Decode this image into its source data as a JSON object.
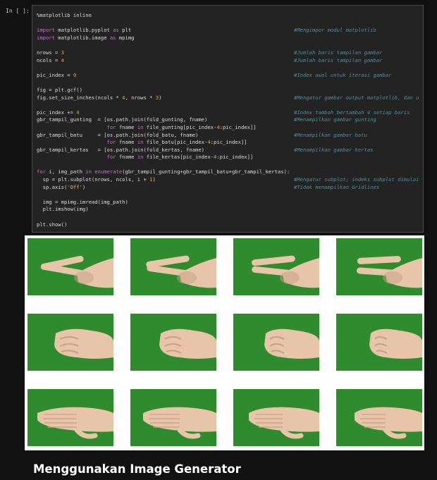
{
  "cell": {
    "prompt": "In [ ]:",
    "lines": [
      {
        "code": "%matplotlib inline",
        "comment": ""
      },
      {
        "code": "",
        "comment": ""
      },
      {
        "code": "import matplotlib.pyplot as plt",
        "comment": "#Mengimpor modul matplotlib"
      },
      {
        "code": "import matplotlib.image as mpimg",
        "comment": ""
      },
      {
        "code": "",
        "comment": ""
      },
      {
        "code": "nrows = 3",
        "comment": "#Jumlah baris tampilan gambar"
      },
      {
        "code": "ncols = 4",
        "comment": "#Jumlah baris tampilan gambar"
      },
      {
        "code": "",
        "comment": ""
      },
      {
        "code": "pic_index = 0",
        "comment": "#Index awal untuk iterasi gambar"
      },
      {
        "code": "",
        "comment": ""
      },
      {
        "code": "fig = plt.gcf()",
        "comment": ""
      },
      {
        "code": "fig.set_size_inches(ncols * 4, nrows * 3)",
        "comment": "#Mengatur gambar output matplotlib, dan u"
      },
      {
        "code": "",
        "comment": ""
      },
      {
        "code": "pic_index += 4",
        "comment": "#Index tambah bertambah 4 setiap baris"
      },
      {
        "code": "gbr_tampil_gunting  = [os.path.join(fold_gunting, fname)",
        "comment": "#Menampilkan gambar gunting"
      },
      {
        "code": "                       for fname in file_gunting[pic_index-4:pic_index]]",
        "comment": ""
      },
      {
        "code": "gbr_tampil_batu     = [os.path.join(fold_batu, fname)",
        "comment": "#Menampilkan gambar batu"
      },
      {
        "code": "                       for fname in file_batu[pic_index-4:pic_index]]",
        "comment": ""
      },
      {
        "code": "gbr_tampil_kertas   = [os.path.join(fold_kertas, fname)",
        "comment": "#Menampilkan gambar kertas"
      },
      {
        "code": "                       for fname in file_kertas[pic_index-4:pic_index]]",
        "comment": ""
      },
      {
        "code": "",
        "comment": ""
      },
      {
        "code": "for i, img_path in enumerate(gbr_tampil_gunting+gbr_tampil_batu+gbr_tampil_kertas):",
        "comment": ""
      },
      {
        "code": "  sp = plt.subplot(nrows, ncols, i + 1)",
        "comment": "#Mengatur subplot; indeks subplot dimulai"
      },
      {
        "code": "  sp.axis('Off')",
        "comment": "#Tidak menampilkan Gridlines"
      },
      {
        "code": "",
        "comment": ""
      },
      {
        "code": "  img = mpimg.imread(img_path)",
        "comment": ""
      },
      {
        "code": "  plt.imshow(img)",
        "comment": ""
      },
      {
        "code": "",
        "comment": ""
      },
      {
        "code": "plt.show()",
        "comment": ""
      }
    ]
  },
  "output": {
    "rows": [
      {
        "gesture": "scissors",
        "images": [
          "scissors-hand-1",
          "scissors-hand-2",
          "scissors-hand-3",
          "scissors-hand-4"
        ]
      },
      {
        "gesture": "rock",
        "images": [
          "rock-hand-1",
          "rock-hand-2",
          "rock-hand-3",
          "rock-hand-4"
        ]
      },
      {
        "gesture": "paper",
        "images": [
          "paper-hand-1",
          "paper-hand-2",
          "paper-hand-3",
          "paper-hand-4"
        ]
      }
    ],
    "background_color": "#2e8b2e",
    "skin_color": "#e8c4a8"
  },
  "section": {
    "title": "Menggunakan Image Generator"
  }
}
